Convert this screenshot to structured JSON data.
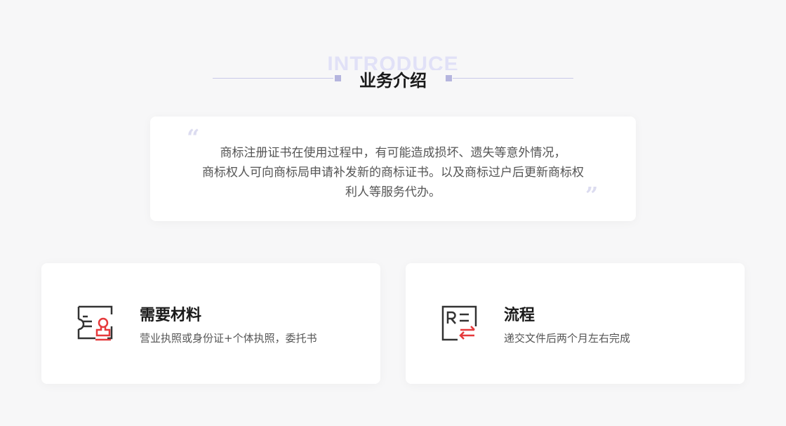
{
  "section": {
    "bg_word": "INTRODUCE",
    "title": "业务介绍"
  },
  "intro": {
    "open_quote": "“",
    "close_quote": "”",
    "lines": [
      "商标注册证书在使用过程中，有可能造成损坏、遗失等意外情况，",
      "商标权人可向商标局申请补发新的商标证书。以及商标过户后更新商标权",
      "利人等服务代办。"
    ]
  },
  "features": [
    {
      "icon": "document-stamp-icon",
      "title": "需要材料",
      "desc": "营业执照或身份证+个体执照，委托书"
    },
    {
      "icon": "registered-transfer-icon",
      "title": "流程",
      "desc": "递交文件后两个月左右完成"
    }
  ],
  "colors": {
    "accent": "#e5393b",
    "icon_dark": "#333333",
    "line": "#c9c9ea"
  }
}
